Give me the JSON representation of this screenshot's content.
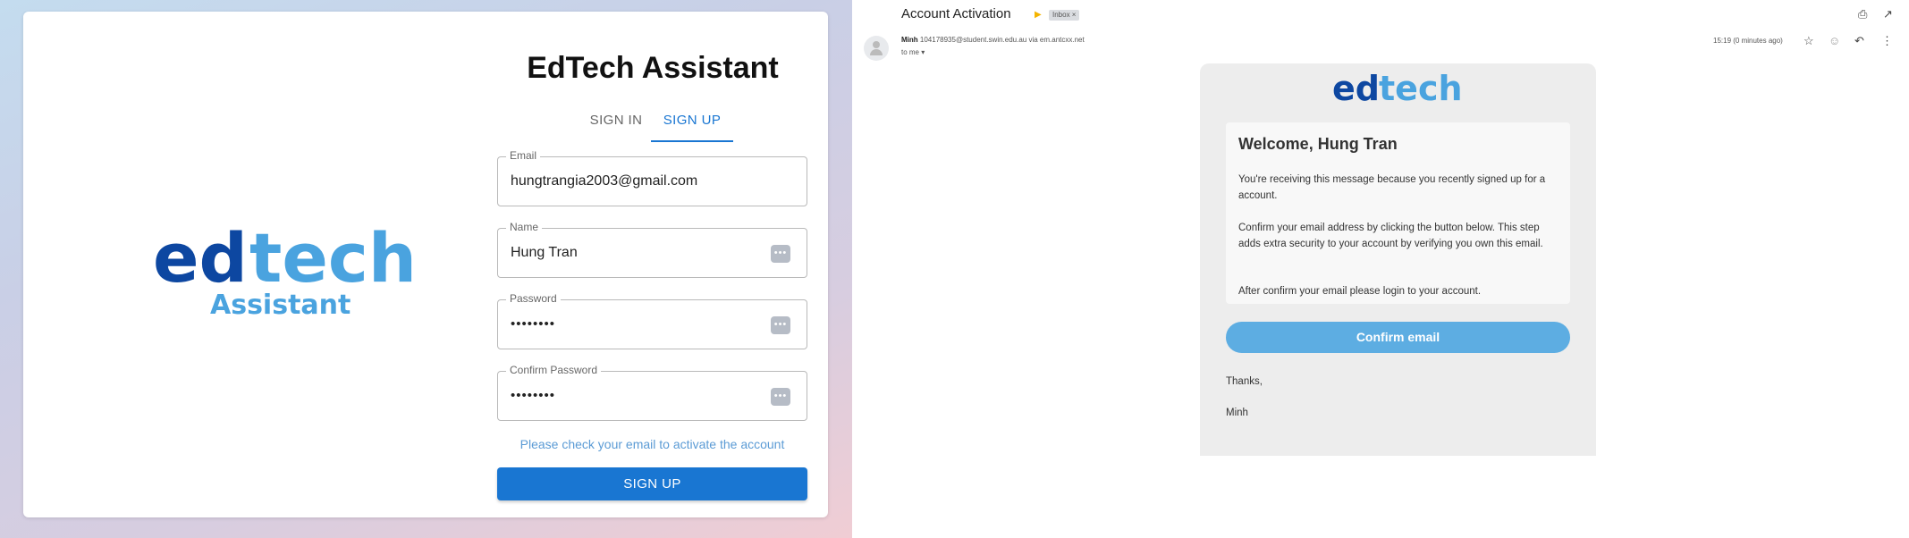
{
  "signup_app": {
    "logo": {
      "word_dark": "ed",
      "word_light": "tech",
      "subtitle": "Assistant",
      "colors": {
        "dark": "#0d47a1",
        "light": "#4aa3df"
      }
    },
    "title": "EdTech Assistant",
    "tabs": [
      {
        "label": "SIGN IN",
        "active": false
      },
      {
        "label": "SIGN UP",
        "active": true
      }
    ],
    "fields": {
      "email": {
        "label": "Email",
        "value": "hungtrangia2003@gmail.com"
      },
      "name": {
        "label": "Name",
        "value": "Hung Tran",
        "icon": "password-manager-icon"
      },
      "password": {
        "label": "Password",
        "value": "••••••••",
        "icon": "password-manager-icon"
      },
      "confirm_password": {
        "label": "Confirm Password",
        "value": "••••••••",
        "icon": "password-manager-icon"
      }
    },
    "status_message": "Please check your email to activate the account",
    "submit_label": "SIGN UP",
    "accent_color": "#1976d2"
  },
  "email_view": {
    "subject": "Account Activation",
    "label_chip": "Inbox ×",
    "sender_name": "Minh",
    "sender_address": "104178935@student.swin.edu.au via em.antcxx.net",
    "recipient": "to me ▾",
    "timestamp": "15:19 (0 minutes ago)",
    "body": {
      "logo": {
        "word_dark": "ed",
        "word_light": "tech"
      },
      "greeting": "Welcome, Hung Tran",
      "paragraphs": [
        "You're receiving this message because you recently signed up for a account.",
        "Confirm your email address by clicking the button below. This step adds extra security to your account by verifying you own this email.",
        "After confirm your email please login to your account."
      ],
      "button_label": "Confirm email",
      "closing": "Thanks,",
      "signature": "Minh"
    }
  }
}
